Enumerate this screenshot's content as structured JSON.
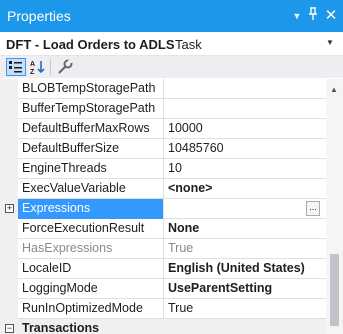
{
  "window": {
    "title": "Properties",
    "dropdown_glyph": "▼",
    "pin_glyph": "𝌂",
    "close_glyph": "✕"
  },
  "object": {
    "name": "DFT - Load Orders to ADLS",
    "type": "Task",
    "dropdown_glyph": "▼"
  },
  "toolbar": {
    "buttons": [
      "categorized-view-icon",
      "alphabetical-sort-icon",
      "property-pages-icon"
    ]
  },
  "properties": [
    {
      "name": "BLOBTempStoragePath",
      "value": ""
    },
    {
      "name": "BufferTempStoragePath",
      "value": ""
    },
    {
      "name": "DefaultBufferMaxRows",
      "value": "10000"
    },
    {
      "name": "DefaultBufferSize",
      "value": "10485760"
    },
    {
      "name": "EngineThreads",
      "value": "10"
    },
    {
      "name": "ExecValueVariable",
      "value": "<none>"
    },
    {
      "name": "Expressions",
      "value": "",
      "expander": "+",
      "ellipsis": "..."
    },
    {
      "name": "ForceExecutionResult",
      "value": "None"
    },
    {
      "name": "HasExpressions",
      "value": "True"
    },
    {
      "name": "LocaleID",
      "value": "English (United States)"
    },
    {
      "name": "LoggingMode",
      "value": "UseParentSetting"
    },
    {
      "name": "RunInOptimizedMode",
      "value": "True"
    },
    {
      "name": "Transactions",
      "value": "",
      "expander": "−"
    }
  ],
  "scrollbar": {
    "up_glyph": "▲"
  },
  "colors": {
    "title_bar": "#1c97ea",
    "selection": "#3399ff"
  }
}
